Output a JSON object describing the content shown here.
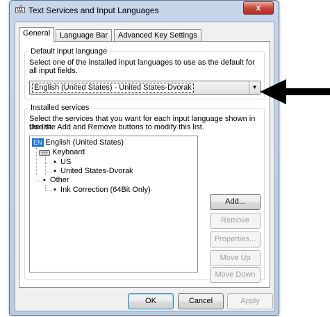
{
  "window": {
    "title": "Text Services and Input Languages",
    "close_glyph": "x"
  },
  "tabs": [
    "General",
    "Language Bar",
    "Advanced Key Settings"
  ],
  "default_input": {
    "legend": "Default input language",
    "description": "Select one of the installed input languages to use as the default for all input fields.",
    "selected": "English (United States) - United States-Dvorak"
  },
  "installed": {
    "legend": "Installed services",
    "description_line1": "Select the services that you want for each input language shown in the list.",
    "description_line2": "Use the Add and Remove buttons to modify this list.",
    "tree": {
      "language_badge": "EN",
      "language": "English (United States)",
      "keyboard": "Keyboard",
      "kb_items": [
        "US",
        "United States-Dvorak"
      ],
      "other": "Other",
      "other_items": [
        "Ink Correction (64Bit Only)"
      ]
    },
    "buttons": {
      "add": "Add...",
      "remove": "Remove",
      "properties": "Properties...",
      "move_up": "Move Up",
      "move_down": "Move Down"
    }
  },
  "footer": {
    "ok": "OK",
    "cancel": "Cancel",
    "apply": "Apply"
  },
  "annotation": {
    "arrow_color": "#000000"
  }
}
